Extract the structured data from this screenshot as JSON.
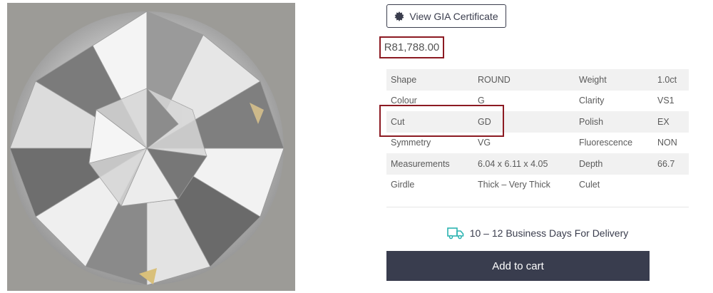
{
  "product_image": {
    "alt_icon": "diamond-image"
  },
  "certificate": {
    "label": "View GIA Certificate",
    "icon": "gia-seal-icon"
  },
  "price": {
    "amount": "R81,788.00"
  },
  "specs": {
    "rows": [
      {
        "k1": "Shape",
        "v1": "ROUND",
        "k2": "Weight",
        "v2": "1.0ct"
      },
      {
        "k1": "Colour",
        "v1": "G",
        "k2": "Clarity",
        "v2": "VS1"
      },
      {
        "k1": "Cut",
        "v1": "GD",
        "k2": "Polish",
        "v2": "EX"
      },
      {
        "k1": "Symmetry",
        "v1": "VG",
        "k2": "Fluorescence",
        "v2": "NON"
      },
      {
        "k1": "Measurements",
        "v1": "6.04 x 6.11 x 4.05",
        "k2": "Depth",
        "v2": "66.7"
      },
      {
        "k1": "Girdle",
        "v1": "Thick – Very Thick",
        "k2": "Culet",
        "v2": ""
      }
    ]
  },
  "delivery": {
    "text": "10 – 12 Business Days For Delivery",
    "icon": "truck-icon"
  },
  "cart": {
    "label": "Add to cart"
  },
  "highlight_color": "#8c1a22",
  "button_color": "#393d4e",
  "accent_color": "#2bb3b1"
}
